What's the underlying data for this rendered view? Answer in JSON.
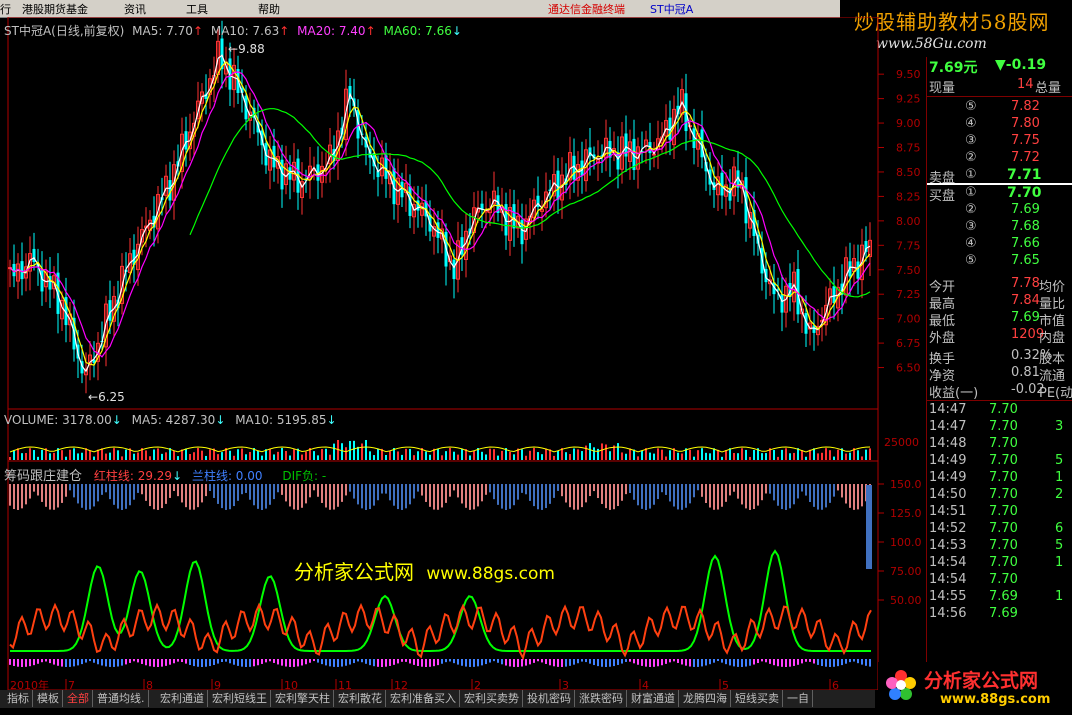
{
  "menubar": {
    "items": [
      "行",
      "港股期货基金",
      "资讯",
      "工具",
      "帮助"
    ],
    "right_red": "通达信金融终端",
    "right_blue": "ST中冠A"
  },
  "brand": {
    "title": "炒股辅助教材58股网",
    "url": "www.58Gu.com"
  },
  "watermark": {
    "text1": "分析家公式网",
    "text2": "www.88gs.com"
  },
  "main_legend": {
    "title": "ST中冠A(日线,前复权)",
    "ma5": "MA5: 7.70",
    "ma10": "MA10: 7.63",
    "ma20": "MA20: 7.40",
    "ma60": "MA60: 7.66",
    "high_label": "9.88",
    "low_label": "6.25"
  },
  "volume_legend": {
    "vol": "VOLUME: 3178.00",
    "ma5": "MA5: 4287.30",
    "ma10": "MA10: 5195.85"
  },
  "indicator_legend": {
    "name": "筹码跟庄建仓",
    "red": "红柱线: 29.29",
    "blue": "兰柱线: 0.00",
    "dif": "DIF负: -"
  },
  "price_axis": [
    "9.50",
    "9.25",
    "9.00",
    "8.75",
    "8.50",
    "8.25",
    "8.00",
    "7.75",
    "7.50",
    "7.25",
    "7.00",
    "6.75",
    "6.50"
  ],
  "volume_axis": [
    "25000"
  ],
  "indicator_axis": [
    "150.0",
    "125.0",
    "100.0",
    "75.00",
    "50.00"
  ],
  "date_labels": [
    "2010年",
    "7",
    "8",
    "9",
    "10",
    "11",
    "12",
    "2",
    "3",
    "4",
    "5",
    "6"
  ],
  "quote": {
    "price": "7.69元",
    "change": "▼-0.19",
    "xianliang_label": "现量",
    "xianliang": "14",
    "zongliang_label": "总量",
    "sell": [
      {
        "n": "⑤",
        "p": "7.82"
      },
      {
        "n": "④",
        "p": "7.80"
      },
      {
        "n": "③",
        "p": "7.75"
      },
      {
        "n": "②",
        "p": "7.72"
      },
      {
        "n": "①",
        "p": "7.71",
        "label": "卖盘"
      }
    ],
    "buy": [
      {
        "n": "①",
        "p": "7.70",
        "label": "买盘"
      },
      {
        "n": "②",
        "p": "7.69"
      },
      {
        "n": "③",
        "p": "7.68"
      },
      {
        "n": "④",
        "p": "7.66"
      },
      {
        "n": "⑤",
        "p": "7.65"
      }
    ],
    "stats": [
      {
        "l": "今开",
        "v": "7.78",
        "r": "均价"
      },
      {
        "l": "最高",
        "v": "7.84",
        "r": "量比"
      },
      {
        "l": "最低",
        "v": "7.69",
        "r": "市值"
      },
      {
        "l": "外盘",
        "v": "1209",
        "r": "内盘"
      },
      {
        "l": "换手",
        "v": "0.32%",
        "r": "股本"
      },
      {
        "l": "净资",
        "v": "0.81",
        "r": "流通"
      },
      {
        "l": "收益(一)",
        "v": "-0.02",
        "r": "PE(动"
      }
    ],
    "ticks": [
      {
        "t": "14:47",
        "p": "7.70",
        "v": ""
      },
      {
        "t": "14:47",
        "p": "7.70",
        "v": "3"
      },
      {
        "t": "14:48",
        "p": "7.70",
        "v": ""
      },
      {
        "t": "14:49",
        "p": "7.70",
        "v": "5"
      },
      {
        "t": "14:49",
        "p": "7.70",
        "v": "1"
      },
      {
        "t": "14:50",
        "p": "7.70",
        "v": "2"
      },
      {
        "t": "14:51",
        "p": "7.70",
        "v": ""
      },
      {
        "t": "14:52",
        "p": "7.70",
        "v": "6"
      },
      {
        "t": "14:53",
        "p": "7.70",
        "v": "5"
      },
      {
        "t": "14:54",
        "p": "7.70",
        "v": "1"
      },
      {
        "t": "14:54",
        "p": "7.70",
        "v": ""
      },
      {
        "t": "14:55",
        "p": "7.69",
        "v": "1"
      },
      {
        "t": "14:56",
        "p": "7.69",
        "v": ""
      }
    ]
  },
  "tabs": [
    "指标",
    "模板",
    "全部",
    "普通均线.",
    "宏利通道",
    "宏利短线王",
    "宏利擎天柱",
    "宏利散花",
    "宏利准备买入",
    "宏利买卖势",
    "投机密码",
    "涨跌密码",
    "财富通道",
    "龙腾四海",
    "短线买卖",
    "一自"
  ],
  "active_tab": 2,
  "bottom_logo": {
    "text": "分析家公式网",
    "url": "www.88gs.com"
  },
  "colors": {
    "up": "#ff3232",
    "down": "#00ffff",
    "ma5": "#ffffff",
    "ma10": "#ffff00",
    "ma20": "#ff00ff",
    "ma60": "#00ff00",
    "axis": "#b00000",
    "green_line": "#00ff00",
    "orange_line": "#ff4010",
    "blue_line": "#4080ff"
  }
}
